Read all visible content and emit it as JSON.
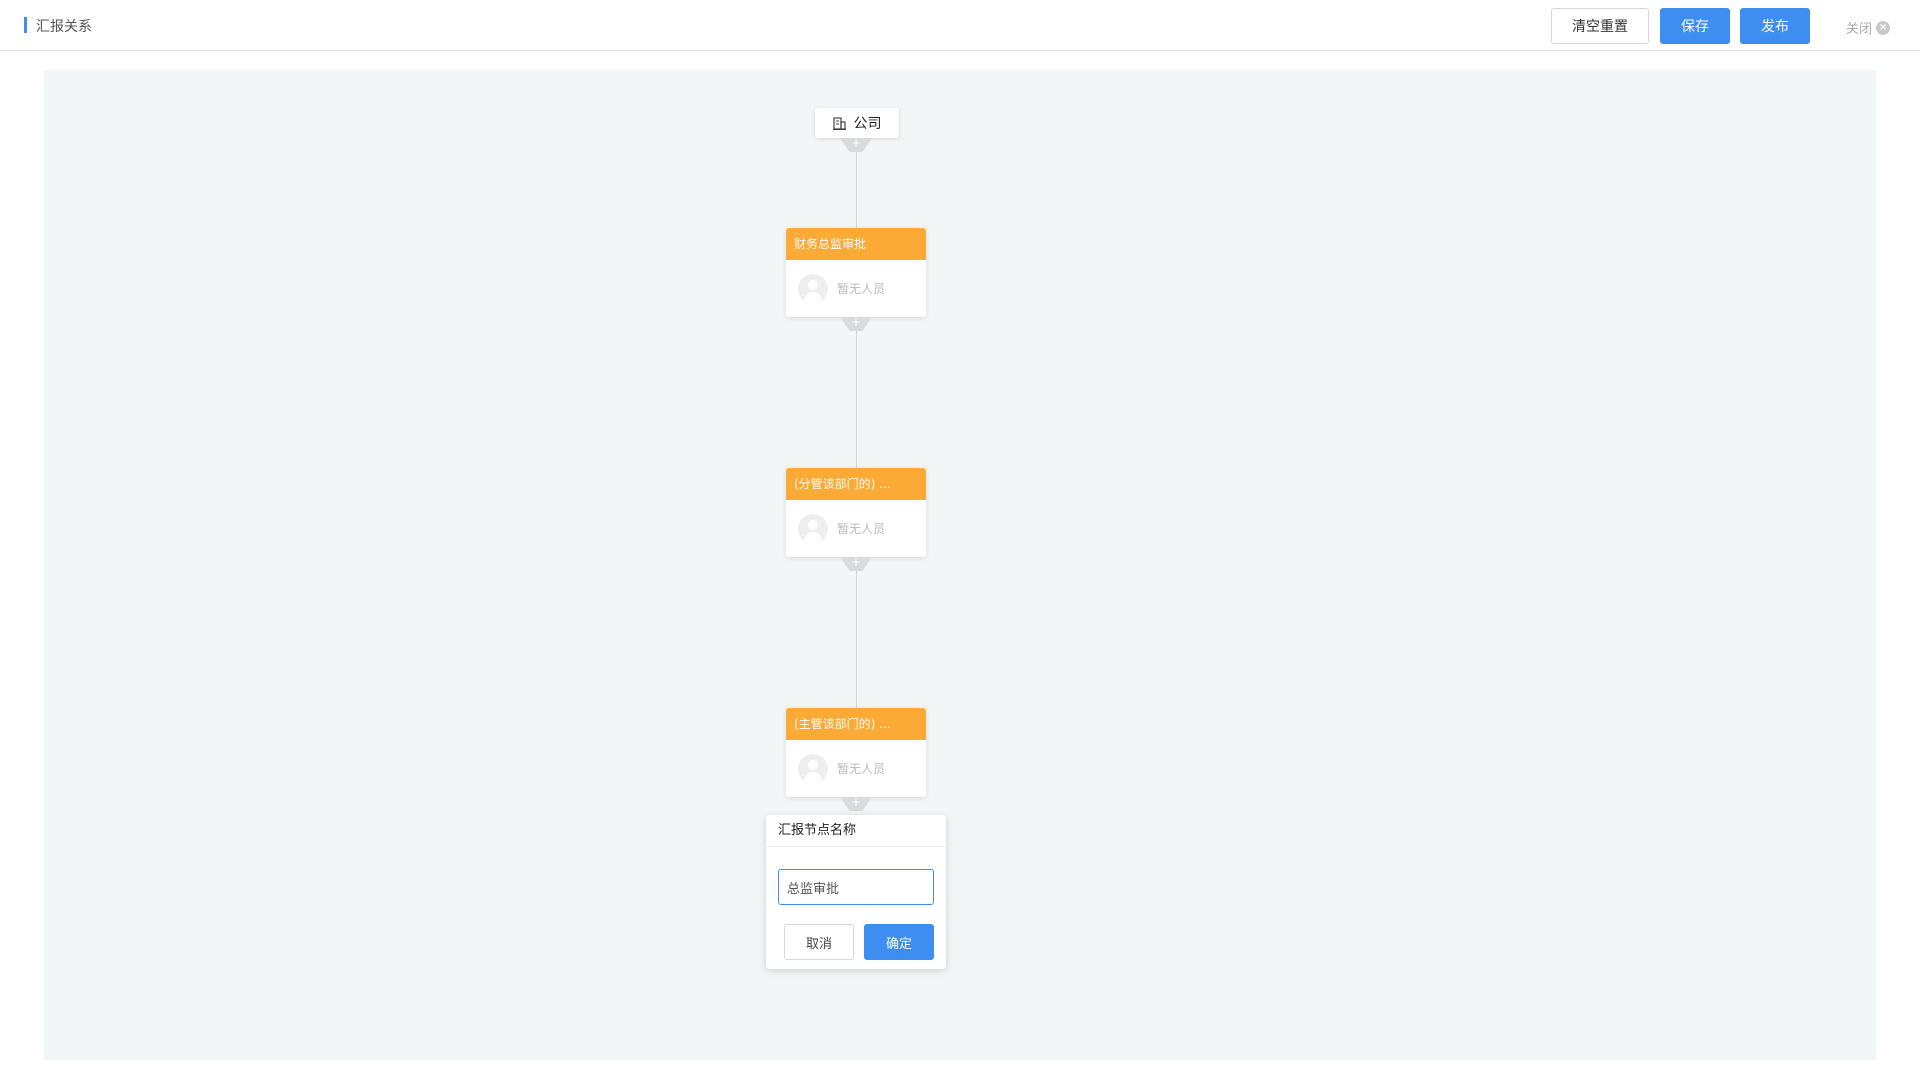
{
  "header": {
    "title": "汇报关系",
    "clear_reset_label": "清空重置",
    "save_label": "保存",
    "publish_label": "发布",
    "close_label": "关闭"
  },
  "colors": {
    "primary": "#3d8ef0",
    "node_header": "#fbaa35",
    "canvas_bg": "#f3f6f7"
  },
  "flow": {
    "root": {
      "label": "公司",
      "icon": "building-icon"
    },
    "add_symbol": "+",
    "nodes": [
      {
        "title": "财务总监审批",
        "assignee": "暂无人员"
      },
      {
        "title": "(分管该部门的) ...",
        "assignee": "暂无人员"
      },
      {
        "title": "(主管该部门的) ...",
        "assignee": "暂无人员"
      }
    ]
  },
  "popover": {
    "title": "汇报节点名称",
    "input_value": "总监审批",
    "cancel_label": "取消",
    "confirm_label": "确定"
  }
}
